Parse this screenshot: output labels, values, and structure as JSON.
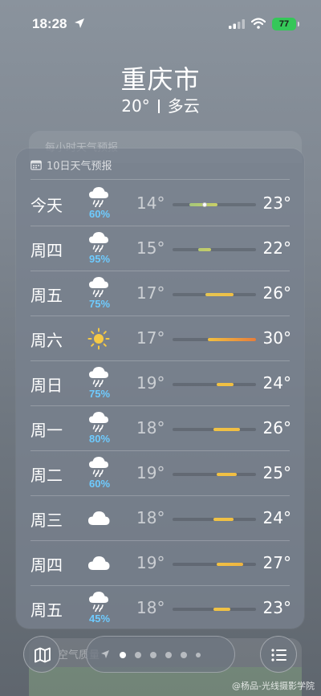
{
  "status_bar": {
    "time": "18:28",
    "battery": "77"
  },
  "header": {
    "city": "重庆市",
    "current_temp": "20°",
    "condition": "多云"
  },
  "ghost_card_title": "每小时天气预报",
  "forecast": {
    "title": "10日天气预报",
    "days": [
      {
        "day": "今天",
        "icon": "rain-cloud-icon",
        "precip": "60%",
        "low": "14°",
        "high": "23°",
        "bar_start": 0.2,
        "bar_end": 0.54,
        "current_marker": 0.38,
        "bar_colors": [
          "#a5c77a",
          "#c9cf66"
        ]
      },
      {
        "day": "周四",
        "icon": "rain-cloud-icon",
        "precip": "95%",
        "low": "15°",
        "high": "22°",
        "bar_start": 0.31,
        "bar_end": 0.46,
        "bar_colors": [
          "#b7ca6f",
          "#c6cc68"
        ]
      },
      {
        "day": "周五",
        "icon": "rain-cloud-icon",
        "precip": "75%",
        "low": "17°",
        "high": "26°",
        "bar_start": 0.39,
        "bar_end": 0.73,
        "bar_colors": [
          "#e4c553",
          "#f0bf44"
        ]
      },
      {
        "day": "周六",
        "icon": "sun-icon",
        "precip": "",
        "low": "17°",
        "high": "30°",
        "bar_start": 0.42,
        "bar_end": 1.0,
        "bar_colors": [
          "#f2c040",
          "#e67d3b"
        ]
      },
      {
        "day": "周日",
        "icon": "rain-cloud-icon",
        "precip": "75%",
        "low": "19°",
        "high": "24°",
        "bar_start": 0.53,
        "bar_end": 0.73,
        "bar_colors": [
          "#f0c144",
          "#f1bf42"
        ]
      },
      {
        "day": "周一",
        "icon": "rain-cloud-icon",
        "precip": "80%",
        "low": "18°",
        "high": "26°",
        "bar_start": 0.49,
        "bar_end": 0.81,
        "bar_colors": [
          "#efc246",
          "#f1bd42"
        ]
      },
      {
        "day": "周二",
        "icon": "rain-cloud-icon",
        "precip": "60%",
        "low": "19°",
        "high": "25°",
        "bar_start": 0.53,
        "bar_end": 0.77,
        "bar_colors": [
          "#f0c144",
          "#f1be42"
        ]
      },
      {
        "day": "周三",
        "icon": "cloud-icon",
        "precip": "",
        "low": "18°",
        "high": "24°",
        "bar_start": 0.49,
        "bar_end": 0.73,
        "bar_colors": [
          "#efc246",
          "#f1bf42"
        ]
      },
      {
        "day": "周四",
        "icon": "cloud-icon",
        "precip": "",
        "low": "19°",
        "high": "27°",
        "bar_start": 0.53,
        "bar_end": 0.85,
        "bar_colors": [
          "#f0c144",
          "#efb440"
        ]
      },
      {
        "day": "周五",
        "icon": "rain-cloud-icon",
        "precip": "45%",
        "low": "18°",
        "high": "23°",
        "bar_start": 0.49,
        "bar_end": 0.69,
        "bar_colors": [
          "#efc246",
          "#f0c043"
        ]
      }
    ]
  },
  "air_quality_title": "空气质量",
  "bottom_nav": {
    "page_count": 6,
    "active_page": 0
  },
  "watermark": "@杨品-光线摄影学院"
}
